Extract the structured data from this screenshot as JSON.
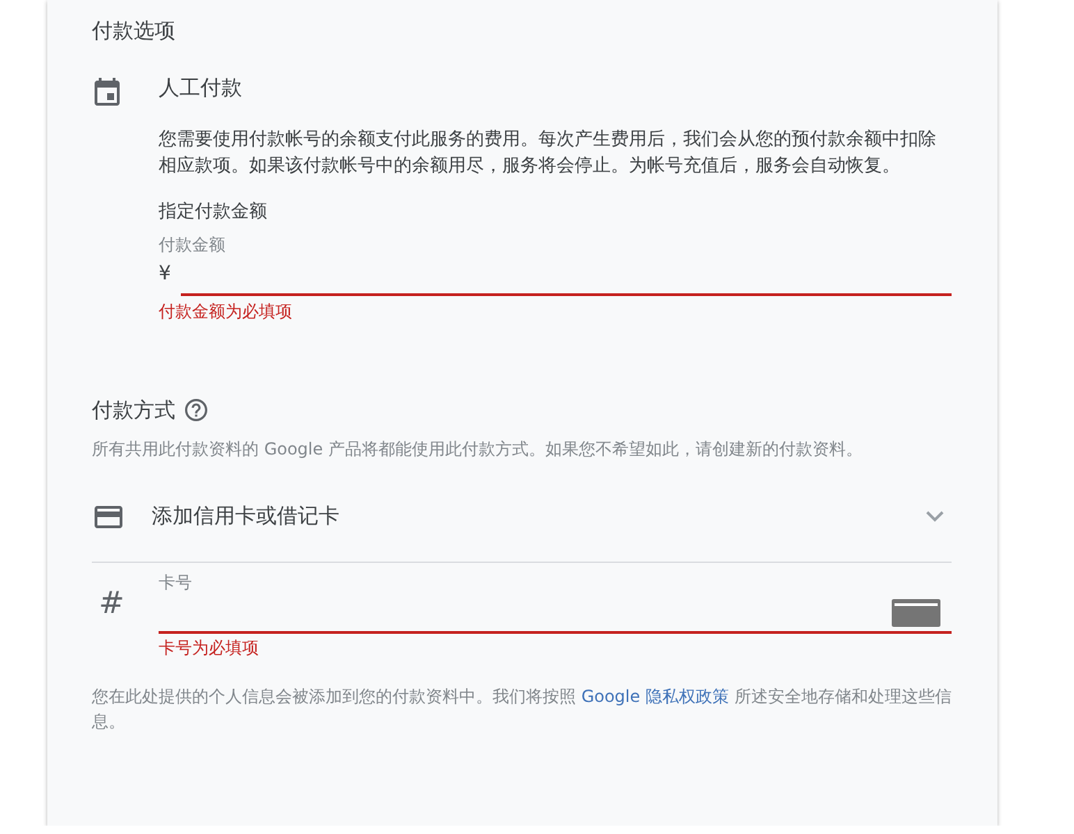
{
  "payment_options": {
    "title": "付款选项",
    "manual_payment": {
      "title": "人工付款",
      "description": "您需要使用付款帐号的余额支付此服务的费用。每次产生费用后，我们会从您的预付款余额中扣除相应款项。如果该付款帐号中的余额用尽，服务将会停止。为帐号充值后，服务会自动恢复。",
      "amount_heading": "指定付款金额",
      "amount_field": {
        "label": "付款金额",
        "prefix": "¥",
        "error": "付款金额为必填项"
      }
    }
  },
  "payment_method": {
    "title": "付款方式",
    "description": "所有共用此付款资料的 Google 产品将都能使用此付款方式。如果您不希望如此，请创建新的付款资料。",
    "add_card": {
      "label": "添加信用卡或借记卡"
    },
    "card_number_field": {
      "symbol": "#",
      "label": "卡号",
      "error": "卡号为必填项"
    },
    "notice": {
      "text_before": "您在此处提供的个人信息会被添加到您的付款资料中。我们将按照 ",
      "link": "Google 隐私权政策",
      "text_after": " 所述安全地存储和处理这些信息。"
    }
  }
}
